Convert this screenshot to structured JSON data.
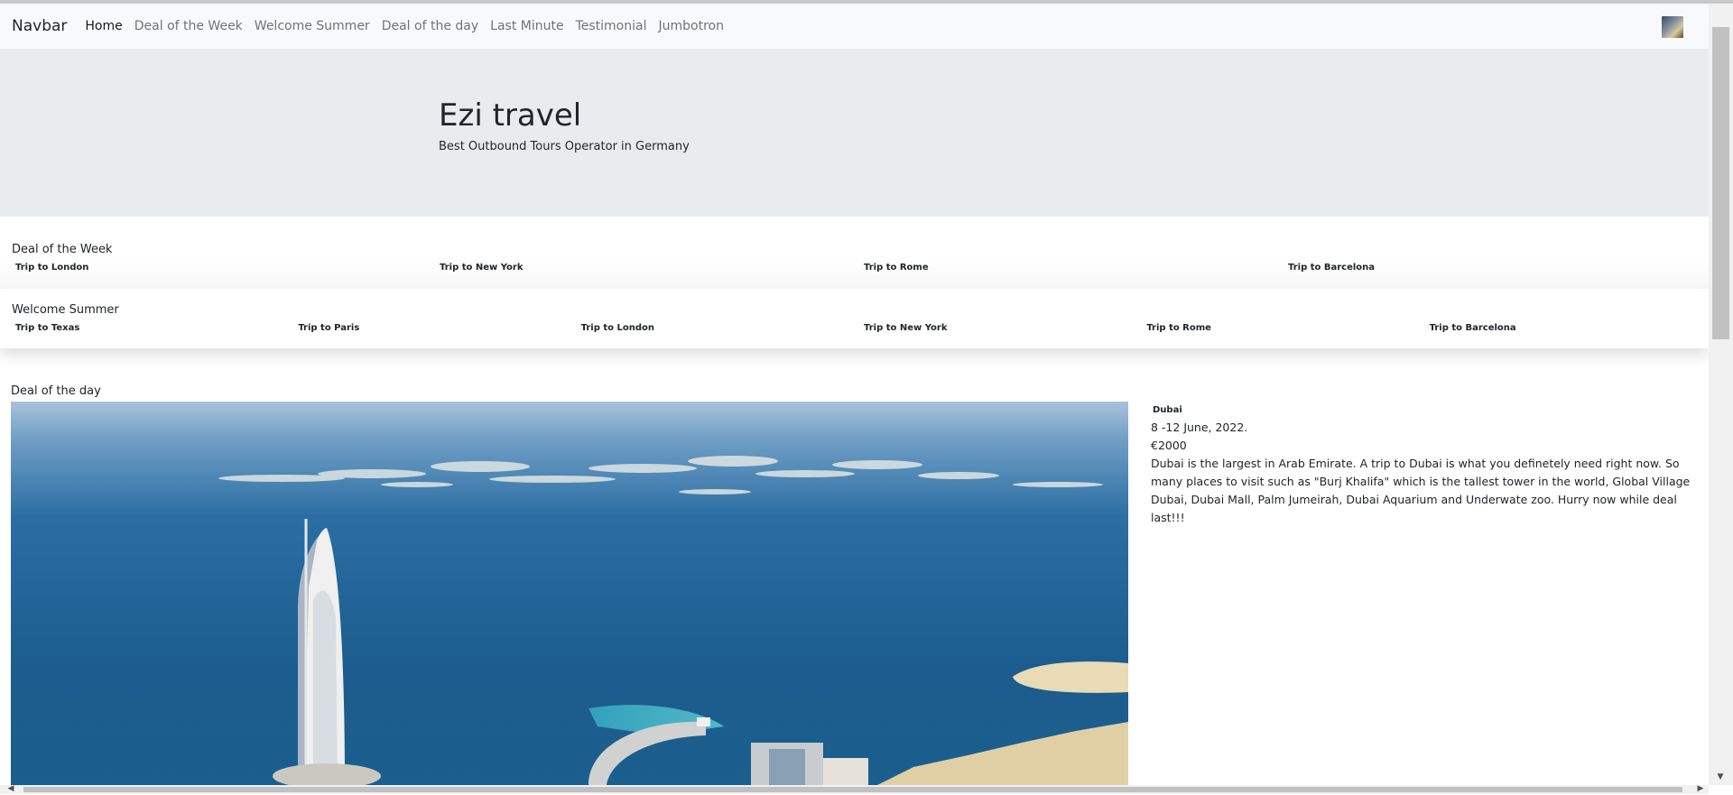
{
  "navbar": {
    "brand": "Navbar",
    "links": [
      "Home",
      "Deal of the Week",
      "Welcome Summer",
      "Deal of the day",
      "Last Minute",
      "Testimonial",
      "Jumbotron"
    ]
  },
  "jumbotron": {
    "title": "Ezi travel",
    "subtitle": "Best Outbound Tours Operator in Germany"
  },
  "deal_of_the_week": {
    "title": "Deal of the Week",
    "trips": [
      "Trip to London",
      "Trip to New York",
      "Trip to Rome",
      "Trip to Barcelona"
    ]
  },
  "welcome_summer": {
    "title": "Welcome Summer",
    "trips": [
      "Trip to Texas",
      "Trip to Paris",
      "Trip to London",
      "Trip to New York",
      "Trip to Rome",
      "Trip to Barcelona"
    ]
  },
  "deal_of_the_day": {
    "title": "Deal of the day",
    "destination": "Dubai",
    "dates": "8 -12 June, 2022.",
    "price": "€2000",
    "description": "Dubai is the largest in Arab Emirate. A trip to Dubai is what you definetely need right now. So many places to visit such as \"Burj Khalifa\" which is the tallest tower in the world, Global Village Dubai, Dubai Mall, Palm Jumeirah, Dubai Aquarium and Underwate zoo. Hurry now while deal last!!!"
  },
  "colors": {
    "navbar_bg": "#f8f9fa",
    "jumbotron_bg": "#e9ecef",
    "sea_dark": "#1e5f8f",
    "sky": "#9dbcd8"
  }
}
